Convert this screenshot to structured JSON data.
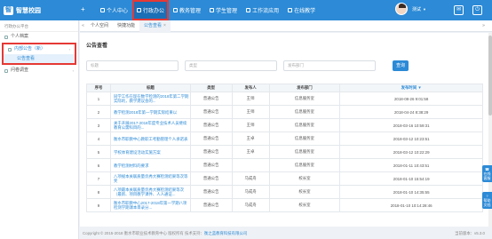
{
  "app": {
    "title": "智慧校园",
    "logo_glyph": "智"
  },
  "nav": {
    "collapse_icon": "+",
    "items": [
      {
        "label": "个人中心"
      },
      {
        "label": "行政办公",
        "active": true
      },
      {
        "label": "教务管理"
      },
      {
        "label": "学生管理"
      },
      {
        "label": "工作流应用"
      },
      {
        "label": "在线教学"
      }
    ]
  },
  "user": {
    "name": "测试",
    "caret": "▼",
    "icons": [
      "mail-icon",
      "power-icon"
    ],
    "mail_glyph": "✉",
    "power_glyph": "⏻"
  },
  "sidebar": {
    "header": "行政办公平台",
    "items": [
      {
        "label": "个人档案"
      },
      {
        "label": "内部公告（新）",
        "open": true,
        "caret": "‹",
        "sub": [
          "公告查看"
        ]
      },
      {
        "label": "问卷调查",
        "caret": "‹"
      }
    ]
  },
  "tabs": {
    "left_arrow": "«",
    "right_arrow": "»",
    "items": [
      {
        "label": "个人空间"
      },
      {
        "label": "快捷功能"
      },
      {
        "label": "公告查看",
        "active": true,
        "close": "×"
      }
    ]
  },
  "page": {
    "title": "公告查看",
    "filters": [
      {
        "placeholder": "标题"
      },
      {
        "placeholder": "类型"
      },
      {
        "placeholder": "发布部门"
      }
    ],
    "query_button": "查询"
  },
  "table": {
    "headers": [
      "序号",
      "标题",
      "类型",
      "发布人",
      "发布部门",
      "发布时间 ▼"
    ],
    "rows": [
      [
        "1",
        "同学工作在现在数学检测的2018年第二学期实际的，教学建议会的...",
        "普通公告",
        "王师",
        "信息服务室",
        "2018-08-26 9:01:58"
      ],
      [
        "2",
        "教学检测2018年第一学期实际结果以",
        "普通公告",
        "王师",
        "信息服务室",
        "2018-04-24 8:38:29"
      ],
      [
        "3",
        "关于开展2017-2018年度专业技术人员继续教育公需科目的...",
        "普通公告",
        "王师",
        "信息服务室",
        "2018-03-16 10:59:31"
      ],
      [
        "4",
        "衡水市职教中心教职工考勤管理个人承诺表",
        "普通公告",
        "王卓",
        "信息服务室",
        "2018-03-12 10:23:51"
      ],
      [
        "5",
        "学校体育建设活动实施方案",
        "普通公告",
        "王卓",
        "信息服务室",
        "2018-03-12 10:22:29"
      ],
      [
        "6",
        "教学检测材料的要求",
        "普通公告",
        "",
        "信息服务室",
        "2018-01-11 10:43:51"
      ],
      [
        "7",
        "八项规本关联质量优秀大赛检测结果等次等奖",
        "普通公告",
        "马成舟",
        "校长室",
        "2018-01-10 15:54:19"
      ],
      [
        "8",
        "八项最本关联质量优秀大赛检测结果等次（最新、项目教学课件、人人通证...",
        "普通公告",
        "马成舟",
        "校长室",
        "2018-01-10 14:35:55"
      ],
      [
        "9",
        "衡水市职教中心2017-2018年第一学期八项检测学期课本目录分...",
        "普通公告",
        "马成舟",
        "校长室",
        "2018-01-10 10:14:28:46"
      ]
    ]
  },
  "footer": {
    "copyright": "Copyright © 2015-2018   衡水市职业技术教育中心 版权所有  技术支持：",
    "support": "衡之蓝教育科技有限公司",
    "version": "当前版本：v5.3.0"
  },
  "float_buttons": [
    {
      "label": "在线客服",
      "glyph": "☎"
    },
    {
      "label": "帮助文档",
      "glyph": "?"
    }
  ]
}
